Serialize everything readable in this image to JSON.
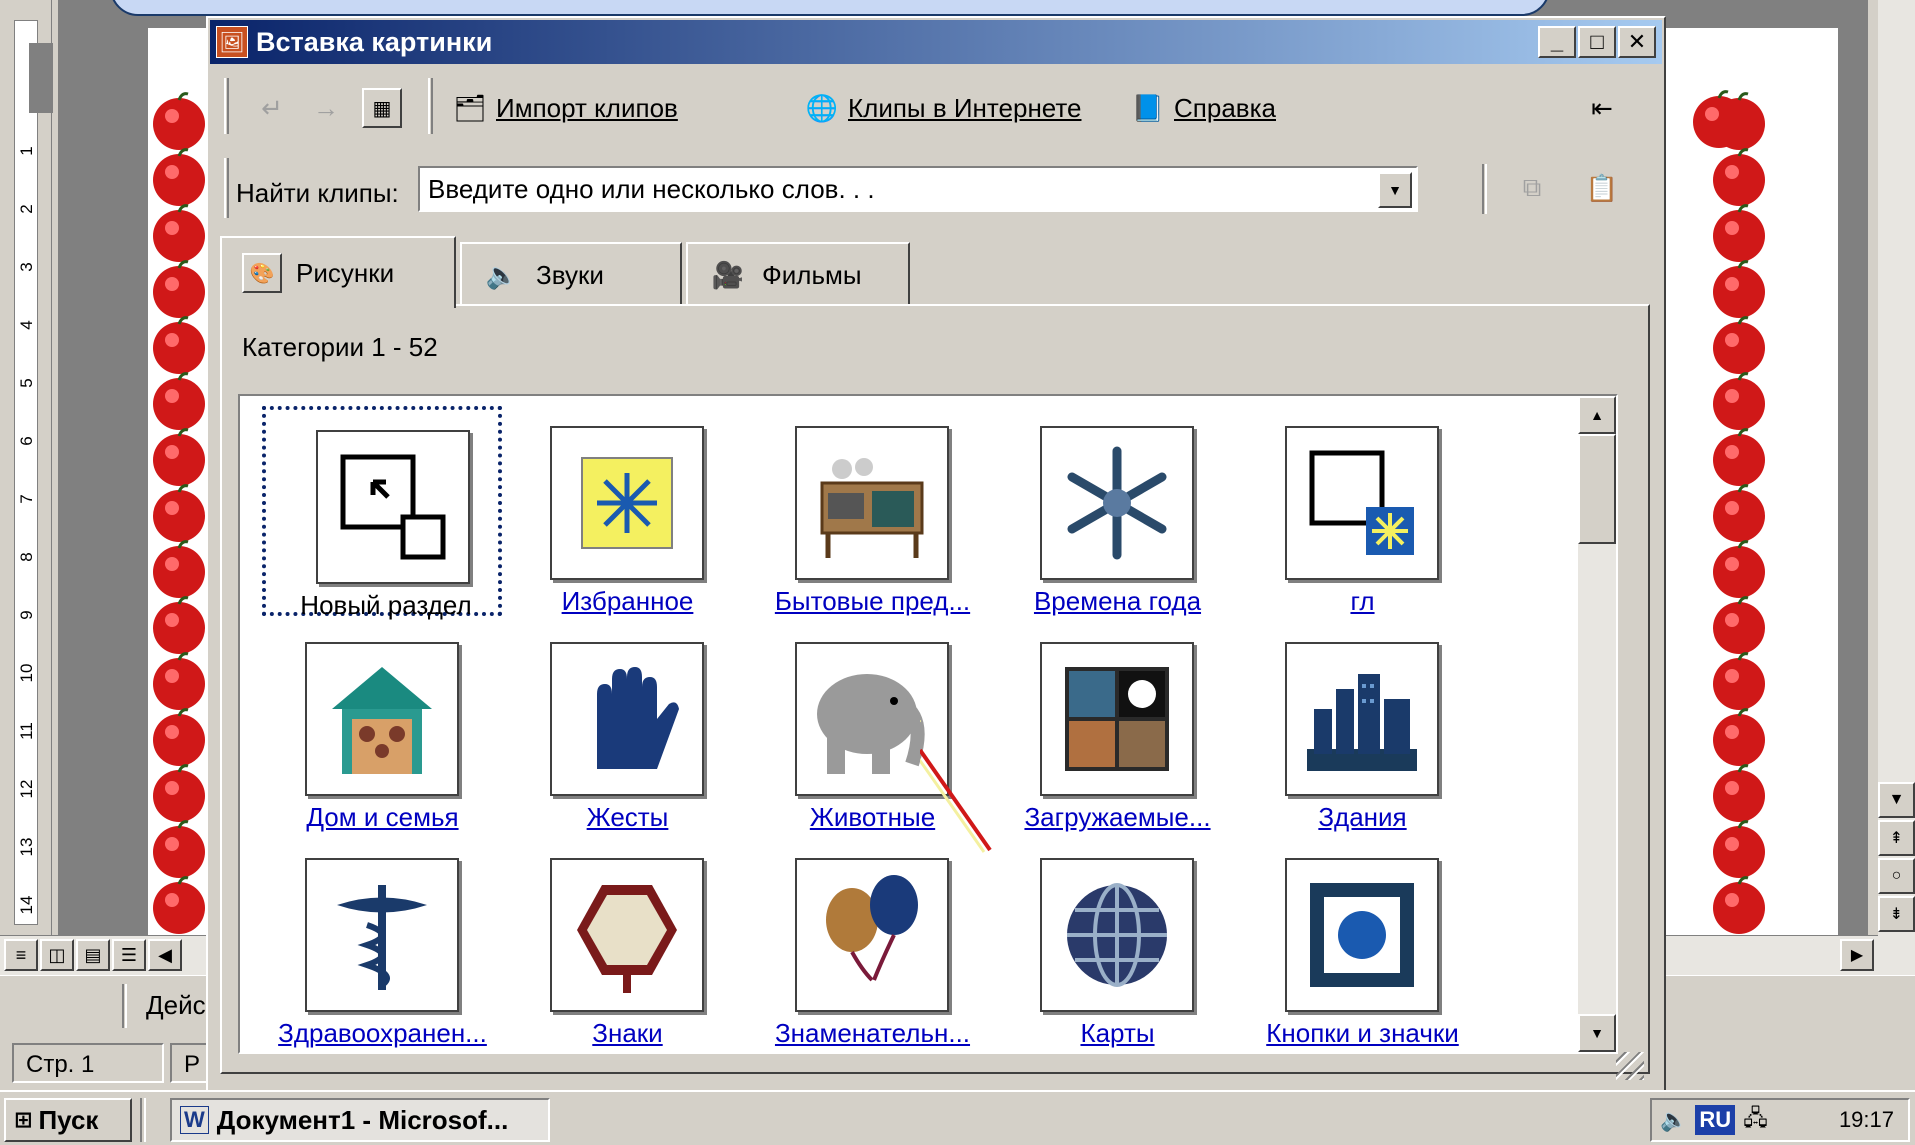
{
  "dialog": {
    "title": "Вставка картинки",
    "toolbar": {
      "back_icon": "back-arrow-icon",
      "forward_icon": "forward-arrow-icon",
      "view_icon": "thumbnail-view-icon",
      "import_label": "Импорт клипов",
      "online_label": "Клипы в Интернете",
      "help_label": "Справка",
      "minimize_icon": "change-window-size-icon"
    },
    "search": {
      "label": "Найти клипы:",
      "value": "Введите одно или несколько слов. . ."
    },
    "tabs": [
      {
        "label": "Рисунки",
        "icon": "pictures-icon",
        "active": true
      },
      {
        "label": "Звуки",
        "icon": "sounds-icon",
        "active": false
      },
      {
        "label": "Фильмы",
        "icon": "movies-icon",
        "active": false
      }
    ],
    "category_count": "Категории 1 - 52",
    "categories": [
      {
        "label": "Новый раздел",
        "icon": "new-category-icon",
        "selected": true
      },
      {
        "label": "Избранное",
        "icon": "favorites-icon"
      },
      {
        "label": "Бытовые пред...",
        "icon": "household-icon"
      },
      {
        "label": "Времена года",
        "icon": "snowflake-icon"
      },
      {
        "label": "гл",
        "icon": "new-category-star-icon"
      },
      {
        "label": "Дом и семья",
        "icon": "home-family-icon"
      },
      {
        "label": "Жесты",
        "icon": "hand-icon"
      },
      {
        "label": "Животные",
        "icon": "elephant-icon"
      },
      {
        "label": "Загружаемые...",
        "icon": "downloaded-icon"
      },
      {
        "label": "Здания",
        "icon": "buildings-icon"
      },
      {
        "label": "Здравоохранен...",
        "icon": "caduceus-icon"
      },
      {
        "label": "Знаки",
        "icon": "sign-icon"
      },
      {
        "label": "Знаменательн...",
        "icon": "balloons-icon"
      },
      {
        "label": "Карты",
        "icon": "globe-icon"
      },
      {
        "label": "Кнопки и значки",
        "icon": "button-icon"
      }
    ]
  },
  "word": {
    "status_page": "Стр. 1",
    "status_col": "Р",
    "draw_actions": "Дейс"
  },
  "taskbar": {
    "start_label": "Пуск",
    "doc_label": "Документ1 - Microsof...",
    "lang": "RU",
    "clock": "19:17"
  },
  "colors": {
    "titlebar_start": "#0a246a",
    "titlebar_end": "#a6caf0",
    "link": "#0000c0",
    "apple": "#d01818"
  }
}
